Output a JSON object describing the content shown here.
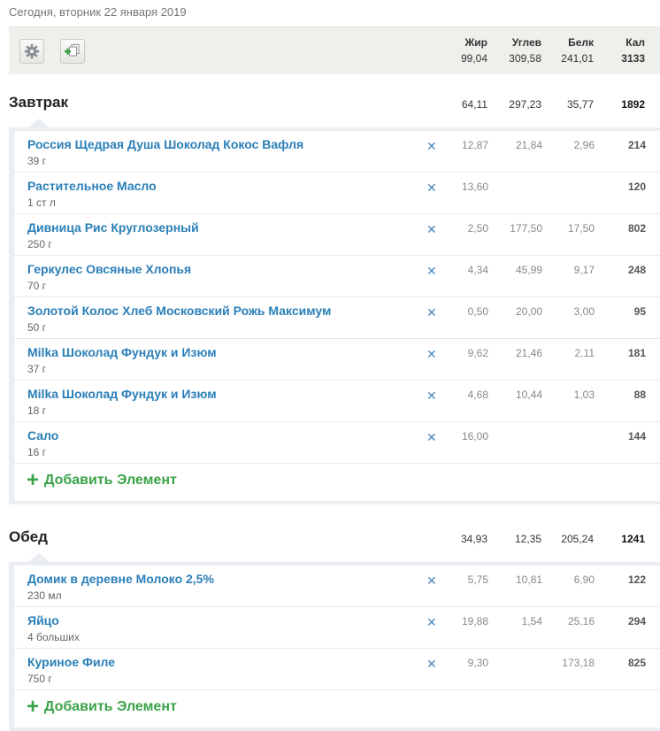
{
  "date_text": "Сегодня, вторник 22 января 2019",
  "colors": {
    "link": "#2a7fb8",
    "add": "#3aa348",
    "delete": "#4a87c0",
    "bar": "#eef0ec"
  },
  "toolbar": {
    "settings_icon": "gear-icon",
    "copy_icon": "add-copy-icon"
  },
  "summary": {
    "fat_label": "Жир",
    "fat": "99,04",
    "carb_label": "Углев",
    "carb": "309,58",
    "protein_label": "Белк",
    "protein": "241,01",
    "cal_label": "Кал",
    "cal": "3133"
  },
  "meals": [
    {
      "title": "Завтрак",
      "fat": "64,11",
      "carb": "297,23",
      "protein": "35,77",
      "cal": "1892",
      "items": [
        {
          "name": "Россия Щедрая Душа Шоколад Кокос Вафля",
          "qty": "39 г",
          "fat": "12,87",
          "carb": "21,84",
          "protein": "2,96",
          "cal": "214"
        },
        {
          "name": "Растительное Масло",
          "qty": "1 ст л",
          "fat": "13,60",
          "carb": "",
          "protein": "",
          "cal": "120"
        },
        {
          "name": "Дивница Рис Круглозерный",
          "qty": "250 г",
          "fat": "2,50",
          "carb": "177,50",
          "protein": "17,50",
          "cal": "802"
        },
        {
          "name": "Геркулес Овсяные Хлопья",
          "qty": "70 г",
          "fat": "4,34",
          "carb": "45,99",
          "protein": "9,17",
          "cal": "248"
        },
        {
          "name": "Золотой Колос Хлеб Московский Рожь Максимум",
          "qty": "50 г",
          "fat": "0,50",
          "carb": "20,00",
          "protein": "3,00",
          "cal": "95"
        },
        {
          "name": "Milka Шоколад Фундук и Изюм",
          "qty": "37 г",
          "fat": "9,62",
          "carb": "21,46",
          "protein": "2,11",
          "cal": "181"
        },
        {
          "name": "Milka Шоколад Фундук и Изюм",
          "qty": "18 г",
          "fat": "4,68",
          "carb": "10,44",
          "protein": "1,03",
          "cal": "88"
        },
        {
          "name": "Сало",
          "qty": "16 г",
          "fat": "16,00",
          "carb": "",
          "protein": "",
          "cal": "144"
        }
      ],
      "add_label": "Добавить Элемент"
    },
    {
      "title": "Обед",
      "fat": "34,93",
      "carb": "12,35",
      "protein": "205,24",
      "cal": "1241",
      "items": [
        {
          "name": "Домик в деревне Молоко 2,5%",
          "qty": "230 мл",
          "fat": "5,75",
          "carb": "10,81",
          "protein": "6,90",
          "cal": "122"
        },
        {
          "name": "Яйцо",
          "qty": "4 больших",
          "fat": "19,88",
          "carb": "1,54",
          "protein": "25,16",
          "cal": "294"
        },
        {
          "name": "Куриное Филе",
          "qty": "750 г",
          "fat": "9,30",
          "carb": "",
          "protein": "173,18",
          "cal": "825"
        }
      ],
      "add_label": "Добавить Элемент"
    }
  ]
}
